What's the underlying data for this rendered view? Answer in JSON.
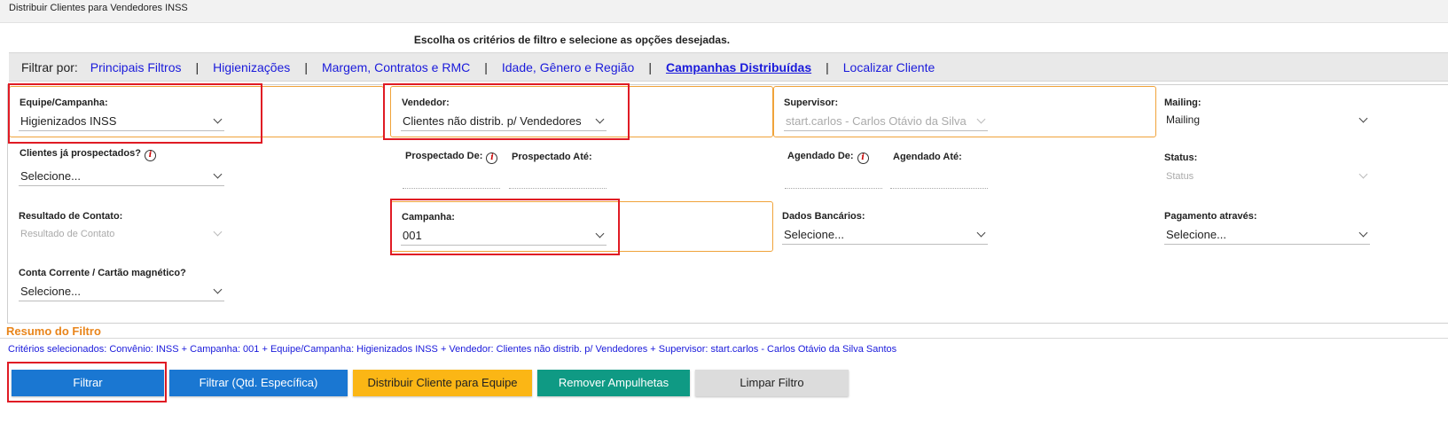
{
  "window": {
    "title": "Distribuir Clientes para Vendedores INSS"
  },
  "instructions": "Escolha os critérios de filtro e selecione as opções desejadas.",
  "filter_bar": {
    "label": "Filtrar por:",
    "tabs": [
      {
        "label": "Principais Filtros",
        "active": false
      },
      {
        "label": "Higienizações",
        "active": false
      },
      {
        "label": "Margem, Contratos e RMC",
        "active": false
      },
      {
        "label": "Idade, Gênero e Região",
        "active": false
      },
      {
        "label": "Campanhas Distribuídas",
        "active": true
      },
      {
        "label": "Localizar Cliente",
        "active": false
      }
    ],
    "separator": "|"
  },
  "fields": {
    "equipe_campanha": {
      "label": "Equipe/Campanha:",
      "value": "Higienizados INSS"
    },
    "vendedor": {
      "label": "Vendedor:",
      "value": "Clientes não distrib. p/ Vendedores"
    },
    "supervisor": {
      "label": "Supervisor:",
      "value": "start.carlos - Carlos Otávio da Silva"
    },
    "mailing": {
      "label": "Mailing:",
      "value": "Mailing"
    },
    "clientes_prospectados": {
      "label": "Clientes já prospectados?",
      "value": "Selecione..."
    },
    "prospectado_de": {
      "label": "Prospectado De:"
    },
    "prospectado_ate": {
      "label": "Prospectado Até:"
    },
    "agendado_de": {
      "label": "Agendado De:"
    },
    "agendado_ate": {
      "label": "Agendado Até:"
    },
    "status": {
      "label": "Status:",
      "value": "Status"
    },
    "resultado_contato": {
      "label": "Resultado de Contato:",
      "value": "Resultado de Contato"
    },
    "campanha": {
      "label": "Campanha:",
      "value": "001"
    },
    "dados_bancarios": {
      "label": "Dados Bancários:",
      "value": "Selecione..."
    },
    "pagamento_atraves": {
      "label": "Pagamento através:",
      "value": "Selecione..."
    },
    "conta_corrente": {
      "label": "Conta Corrente / Cartão magnético?",
      "value": "Selecione..."
    }
  },
  "info_icon_glyph": "i",
  "resumo": {
    "title": "Resumo do Filtro",
    "criteria": "Critérios selecionados: Convênio: INSS + Campanha: 001 + Equipe/Campanha: Higienizados INSS + Vendedor: Clientes não distrib. p/ Vendedores + Supervisor: start.carlos - Carlos Otávio da Silva Santos"
  },
  "buttons": {
    "filtrar": "Filtrar",
    "filtrar_qtd": "Filtrar (Qtd. Específica)",
    "distribuir": "Distribuir Cliente para Equipe",
    "remover": "Remover Ampulhetas",
    "limpar": "Limpar Filtro"
  },
  "colors": {
    "accent_orange": "#f0a33a",
    "highlight_red": "#e01b24",
    "link_blue": "#1a1adb",
    "btn_blue": "#1a77d2",
    "btn_yellow": "#fbb615",
    "btn_teal": "#0f9a84",
    "btn_grey": "#dcdcdc"
  }
}
